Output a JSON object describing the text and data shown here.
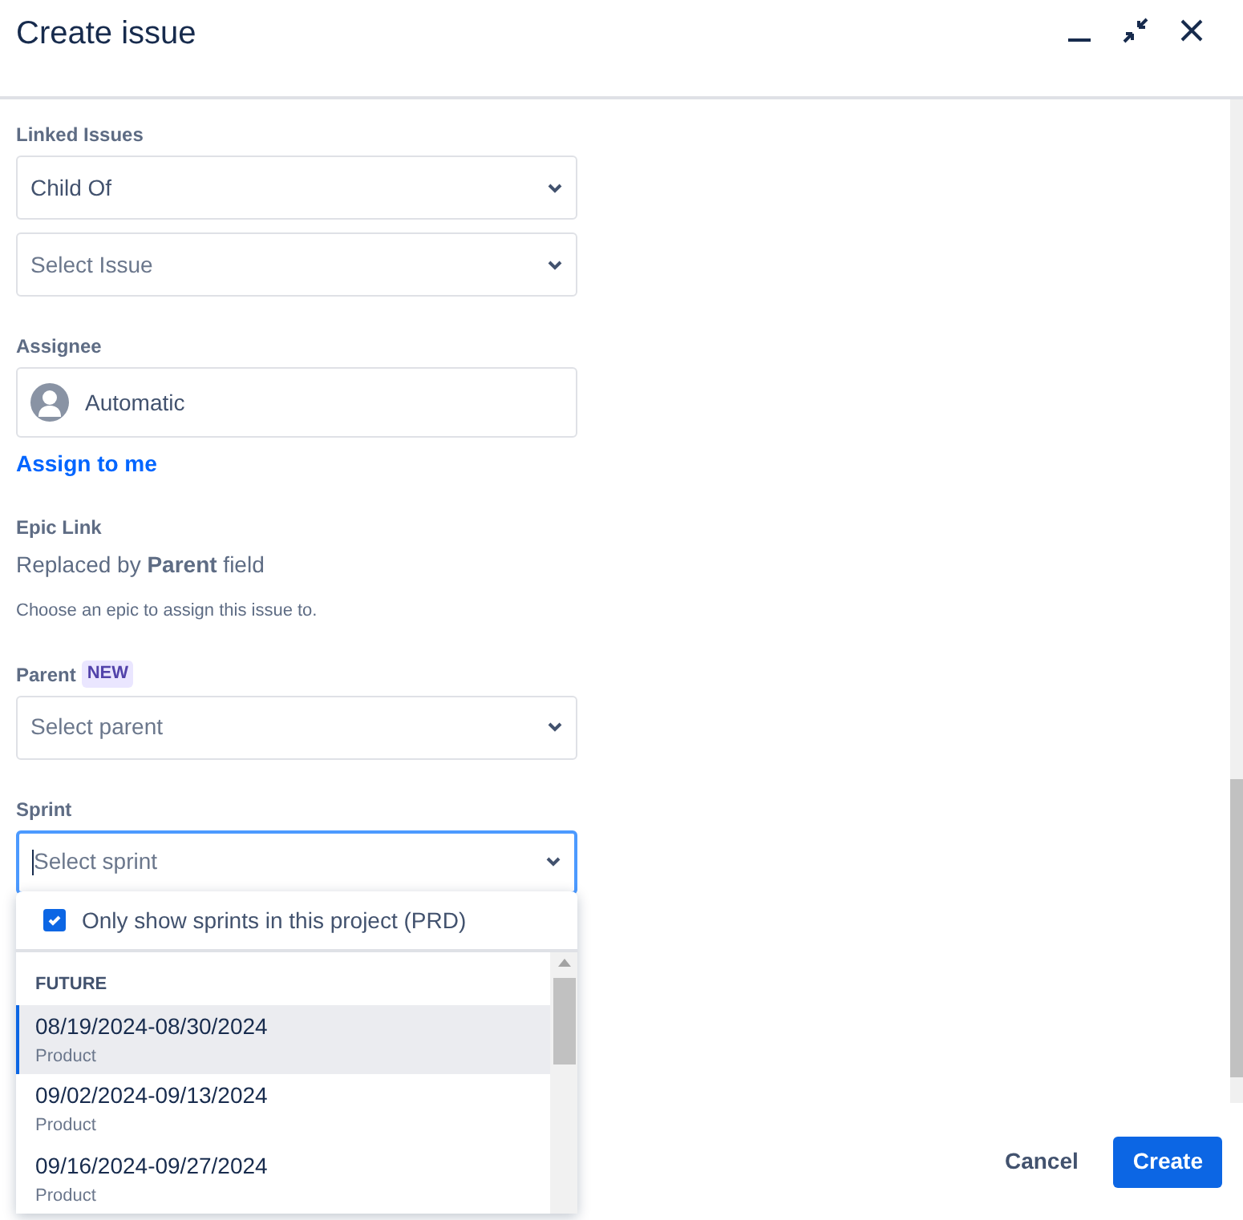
{
  "dialog": {
    "title": "Create issue"
  },
  "linked_issues": {
    "label": "Linked Issues",
    "relation": {
      "value": "Child Of"
    },
    "issue": {
      "placeholder": "Select Issue"
    }
  },
  "assignee": {
    "label": "Assignee",
    "value": "Automatic",
    "assign_link": "Assign to me"
  },
  "epic_link": {
    "label": "Epic Link",
    "note": "Replaced by **Parent** field",
    "help": "Choose an epic to assign this issue to."
  },
  "parent": {
    "label": "Parent",
    "badge": "NEW",
    "placeholder": "Select parent"
  },
  "sprint": {
    "label": "Sprint",
    "placeholder": "Select sprint",
    "focused": true,
    "dropdown": {
      "filter": {
        "label": "Only show sprints in this project (PRD)",
        "checked": true
      },
      "group": "FUTURE",
      "options": [
        {
          "title": "08/19/2024-08/30/2024",
          "subtitle": "Product",
          "selected": true
        },
        {
          "title": "09/02/2024-09/13/2024",
          "subtitle": "Product",
          "selected": false
        },
        {
          "title": "09/16/2024-09/27/2024",
          "subtitle": "Product",
          "selected": false
        }
      ]
    }
  },
  "footer": {
    "buttons": [
      {
        "label": "Cancel",
        "kind": "subtle"
      },
      {
        "label": "Create",
        "kind": "primary"
      }
    ]
  }
}
